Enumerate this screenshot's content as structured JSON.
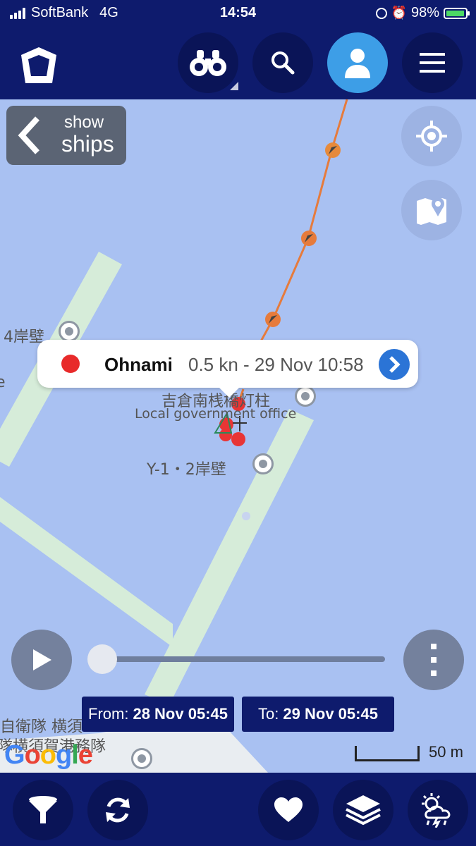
{
  "status_bar": {
    "carrier": "SoftBank",
    "network": "4G",
    "time": "14:54",
    "battery": "98%",
    "battery_level": 0.98
  },
  "top_bar": {
    "icons": [
      "app-logo-icon",
      "binoculars-icon",
      "search-icon",
      "profile-icon",
      "menu-icon"
    ]
  },
  "show_ships": {
    "line1": "show",
    "line2": "ships"
  },
  "popup": {
    "ship_name": "Ohnami",
    "detail": "0.5 kn - 29 Nov 10:58",
    "dot_color": "#e82a2a"
  },
  "map_labels": {
    "berth4": "4岸壁",
    "lighthouse": "吉倉南桟橋灯柱",
    "gov_office": "Local government office",
    "berth_y12": "Y-1・2岸壁",
    "jsdf_line1": "自衛隊 横須",
    "jsdf_line2": "隊横須賀港務隊",
    "edge_letter": "e"
  },
  "timeline": {
    "from_label": "From:",
    "from_value": "28 Nov 05:45",
    "to_label": "To:",
    "to_value": "29 Nov 05:45",
    "position": 0.0
  },
  "google_logo": [
    "G",
    "o",
    "o",
    "g",
    "l",
    "e"
  ],
  "scale_label": "50 m",
  "bottom_bar": {
    "icons": [
      "filter-icon",
      "refresh-icon",
      "heart-icon",
      "layers-icon",
      "weather-icon"
    ]
  },
  "colors": {
    "bar": "#0e1b6d",
    "map_water": "#a9c1f2",
    "pier": "#d6ecd9",
    "track": "#e67b3c",
    "accent_blue": "#2b74d6"
  }
}
